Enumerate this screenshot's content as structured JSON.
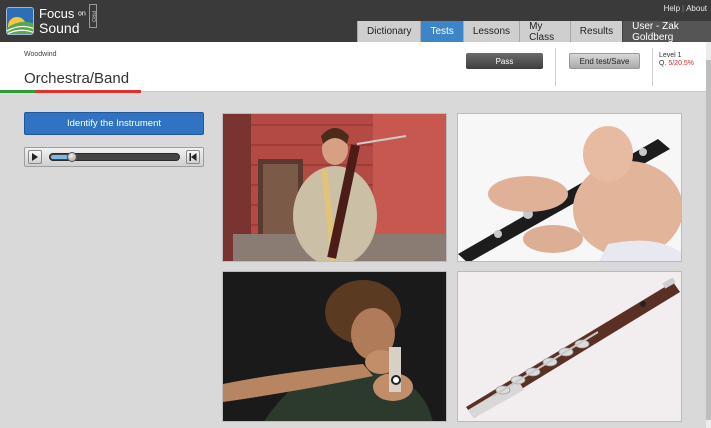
{
  "app": {
    "logo_line1": "Focus",
    "logo_on": "on",
    "logo_line2": "Sound",
    "logo_badge": "PRO"
  },
  "toplinks": {
    "help": "Help",
    "about": "About"
  },
  "nav": {
    "tabs": [
      {
        "label": "Dictionary",
        "active": false
      },
      {
        "label": "Tests",
        "active": true
      },
      {
        "label": "Lessons",
        "active": false
      },
      {
        "label": "My Class",
        "active": false
      },
      {
        "label": "Results",
        "active": false
      }
    ],
    "user": "User - Zak Goldberg"
  },
  "header": {
    "breadcrumb": "Woodwind",
    "title": "Orchestra/Band",
    "pass_label": "Pass",
    "end_label": "End test/Save",
    "level_label": "Level 1",
    "question_prefix": "Q.",
    "question_score": "5/20.5%"
  },
  "left": {
    "identify_label": "Identify the Instrument",
    "player_progress": 0.13
  },
  "photos": [
    {
      "name": "bassoon-photo",
      "icon": "bassoon"
    },
    {
      "name": "clarinet-photo",
      "icon": "clarinet"
    },
    {
      "name": "recorder-photo",
      "icon": "recorder"
    },
    {
      "name": "piccolo-photo",
      "icon": "piccolo"
    }
  ],
  "colors": {
    "accent": "#3b85c8",
    "progress_green": "#2e9a3a",
    "progress_red": "#e1322c",
    "score_red": "#d52a22"
  }
}
